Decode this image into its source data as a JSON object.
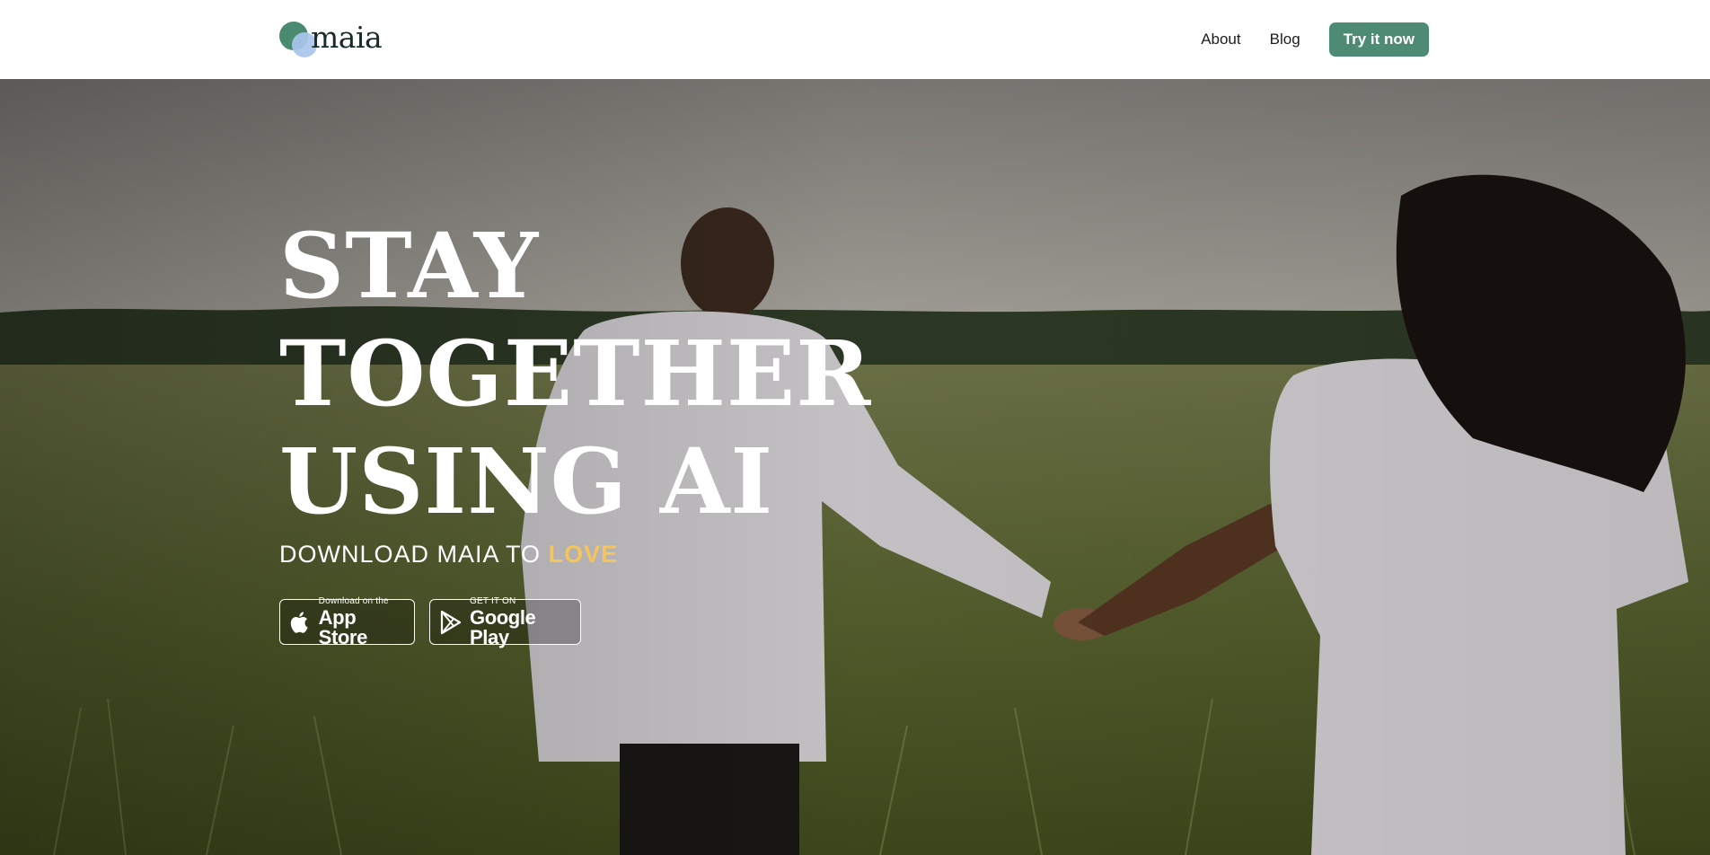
{
  "header": {
    "logo_text": "maia",
    "nav": {
      "about_label": "About",
      "blog_label": "Blog"
    },
    "cta_label": "Try it now"
  },
  "hero": {
    "headline_lines": [
      "STAY",
      "TOGETHER",
      "USING AI"
    ],
    "subhead_prefix": "DOWNLOAD MAIA TO",
    "subhead_accent": "LOVE",
    "app_store": {
      "small_text": "Download on the",
      "big_text": "App Store",
      "icon": "apple-icon"
    },
    "google_play": {
      "small_text": "GET IT ON",
      "big_text": "Google Play",
      "icon": "play-triangle-icon"
    }
  },
  "colors": {
    "brand_green": "#4d8b74",
    "logo_blue": "#a9c6ec",
    "accent_yellow": "#f5c45a"
  }
}
